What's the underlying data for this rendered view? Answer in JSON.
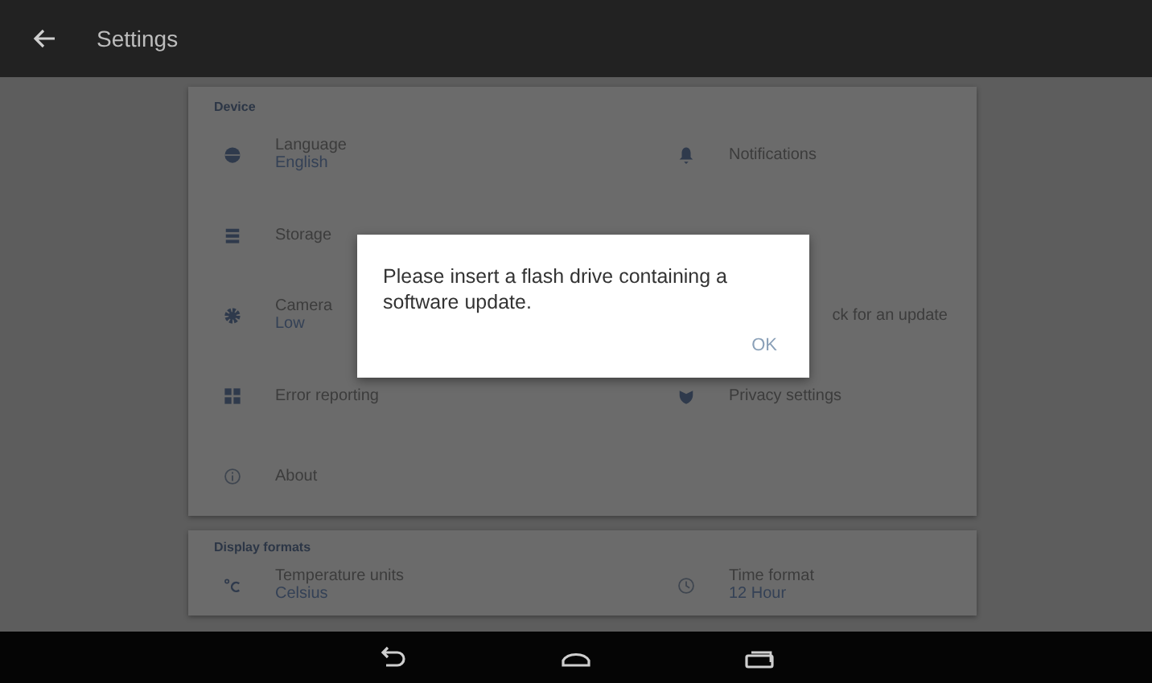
{
  "app_bar": {
    "title": "Settings"
  },
  "sections": [
    {
      "header": "Device",
      "items": [
        {
          "kind": "globe",
          "label": "Language",
          "value": "English"
        },
        {
          "kind": "bell",
          "label": "Notifications"
        },
        {
          "kind": "storage",
          "label": "Storage"
        },
        {
          "kind": "blank"
        },
        {
          "kind": "gear",
          "label": "Camera",
          "value": "Low"
        },
        {
          "kind": "partial",
          "label": "ck for an update"
        },
        {
          "kind": "grid",
          "label": "Error reporting"
        },
        {
          "kind": "shield",
          "label": "Privacy settings"
        },
        {
          "kind": "info",
          "label": "About"
        }
      ]
    },
    {
      "header": "Display formats",
      "items": [
        {
          "kind": "celsius",
          "label": "Temperature units",
          "value": "Celsius"
        },
        {
          "kind": "clock",
          "label": "Time format",
          "value": "12 Hour"
        }
      ]
    }
  ],
  "dialog": {
    "message": "Please insert a flash drive containing a software update.",
    "button": "OK"
  },
  "nav_bar": [
    {
      "kind": "back"
    },
    {
      "kind": "home"
    },
    {
      "kind": "recents"
    }
  ]
}
